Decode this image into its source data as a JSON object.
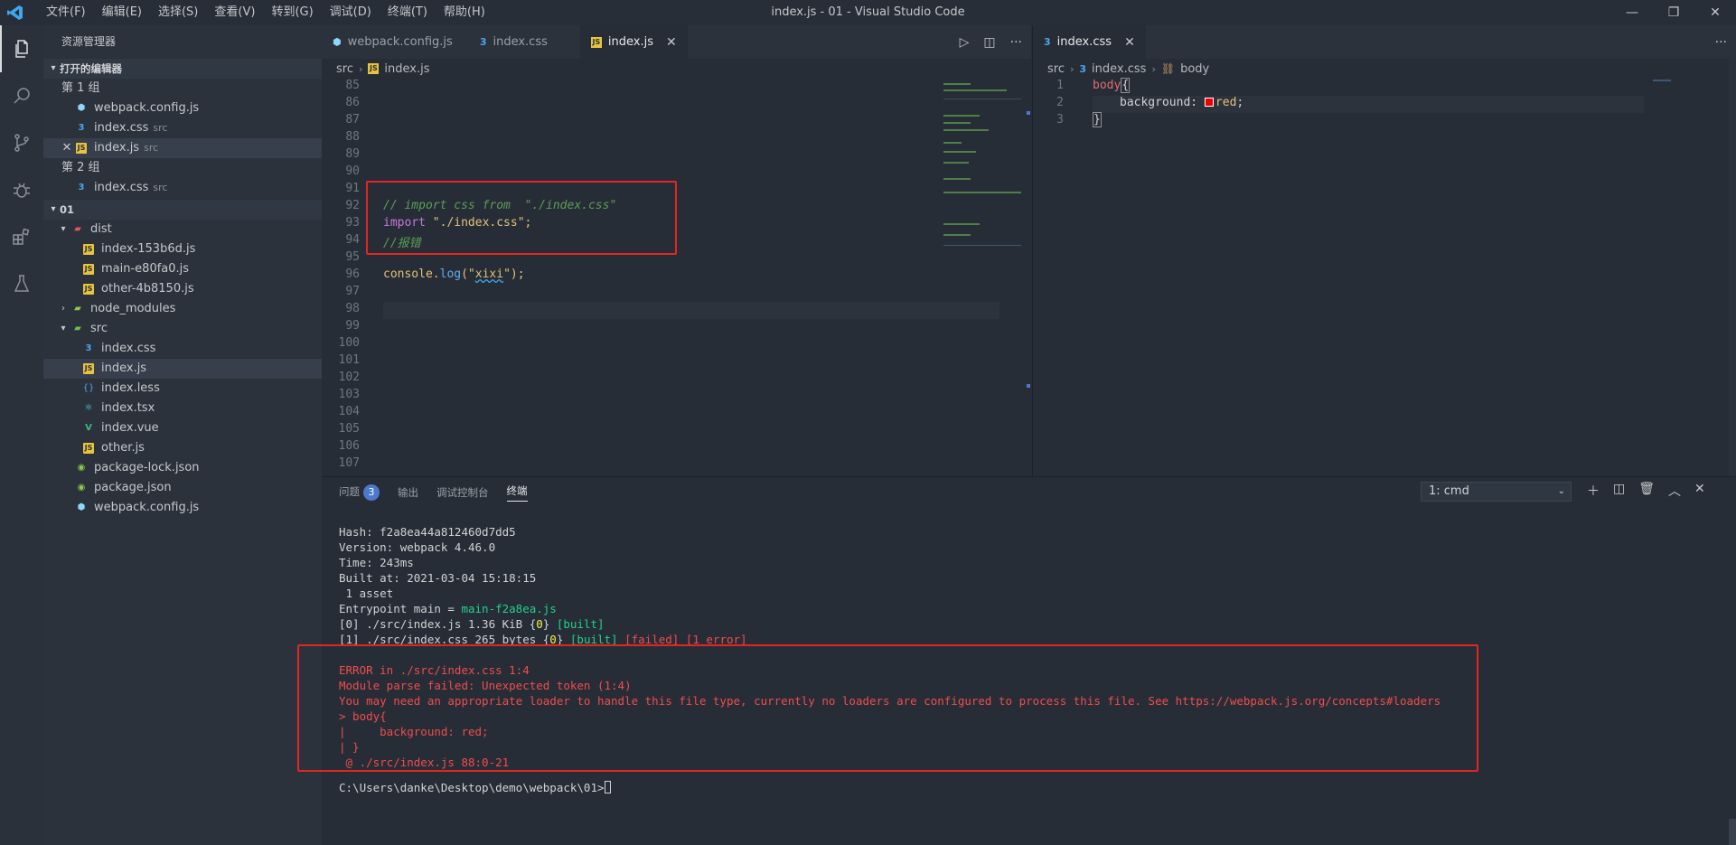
{
  "window": {
    "title": "index.js - 01 - Visual Studio Code"
  },
  "menu": [
    "文件(F)",
    "编辑(E)",
    "选择(S)",
    "查看(V)",
    "转到(G)",
    "调试(D)",
    "终端(T)",
    "帮助(H)"
  ],
  "window_controls": {
    "minimize": "—",
    "restore": "❐",
    "close": "✕"
  },
  "activity_bar": [
    "explorer-icon",
    "search-icon",
    "source-control-icon",
    "debug-icon",
    "extensions-icon",
    "test-flask-icon"
  ],
  "sidebar": {
    "title": "资源管理器",
    "open_editors": {
      "header": "打开的编辑器",
      "group1": "第 1 组",
      "group1_items": [
        {
          "name": "webpack.config.js",
          "hint": ""
        },
        {
          "name": "index.css",
          "hint": "src"
        },
        {
          "name": "index.js",
          "hint": "src"
        }
      ],
      "group2": "第 2 组",
      "group2_items": [
        {
          "name": "index.css",
          "hint": "src"
        }
      ]
    },
    "workspace": {
      "header": "01",
      "dist": "dist",
      "dist_items": [
        "index-153b6d.js",
        "main-e80fa0.js",
        "other-4b8150.js"
      ],
      "node_modules": "node_modules",
      "src": "src",
      "src_items": [
        "index.css",
        "index.js",
        "index.less",
        "index.tsx",
        "index.vue",
        "other.js"
      ],
      "root_items": [
        "package-lock.json",
        "package.json",
        "webpack.config.js"
      ]
    }
  },
  "editor1": {
    "tabs": [
      "webpack.config.js",
      "index.css",
      "index.js"
    ],
    "active_tab": "index.js",
    "breadcrumb": [
      "src",
      "index.js"
    ],
    "line_numbers": [
      "85",
      "86",
      "87",
      "88",
      "89",
      "90",
      "91",
      "92",
      "93",
      "94",
      "95",
      "96",
      "97",
      "98",
      "99",
      "100",
      "101",
      "102",
      "103",
      "104",
      "105",
      "106",
      "107"
    ],
    "comment1": "// import css from  \"./index.css\"",
    "import_kw": "import",
    "import_str": " \"./index.css\";",
    "comment2": "//报错",
    "console_obj": "console.",
    "console_fn": "log",
    "console_open": "(\"",
    "console_arg": "xixi",
    "console_close": "\");"
  },
  "editor2": {
    "tab": "index.css",
    "breadcrumb": [
      "src",
      "index.css",
      "body"
    ],
    "line_numbers": [
      "1",
      "2",
      "3"
    ],
    "line1_sel": "body",
    "line1_brace": "{",
    "line2_prop": "background: ",
    "line2_val": "red",
    "line2_end": ";",
    "line3": "}"
  },
  "panel": {
    "tabs": [
      "问题",
      "输出",
      "调试控制台",
      "终端"
    ],
    "problems_count": "3",
    "active_tab": "终端",
    "terminal_select": "1: cmd",
    "terminal": {
      "hash": "Hash: f2a8ea44a812460d7dd5",
      "version": "Version: webpack 4.46.0",
      "time": "Time: 243ms",
      "built_at": "Built at: 2021-03-04 15:18:15",
      "assets": " 1 asset",
      "entry_label": "Entrypoint main = ",
      "entry_file": "main-f2a8ea.js",
      "line0_a": "[0] ./src/index.js 1.36 KiB {",
      "line0_b": "0",
      "line0_c": "} ",
      "line0_d": "[built]",
      "line1_a": "[1] ./src/index.css 265 bytes {",
      "line1_b": "0",
      "line1_c": "} ",
      "line1_d": "[built]",
      "line1_e": " [failed] [1 error]",
      "error_lines": [
        "ERROR in ./src/index.css 1:4",
        "Module parse failed: Unexpected token (1:4)",
        "You may need an appropriate loader to handle this file type, currently no loaders are configured to process this file. See https://webpack.js.org/concepts#loaders",
        "> body{",
        "|     background: red;",
        "| }",
        " @ ./src/index.js 88:0-21"
      ],
      "prompt": "C:\\Users\\danke\\Desktop\\demo\\webpack\\01>"
    }
  },
  "colors": {
    "highlight_box": "#e3261f",
    "accent": "#4d78cc"
  }
}
